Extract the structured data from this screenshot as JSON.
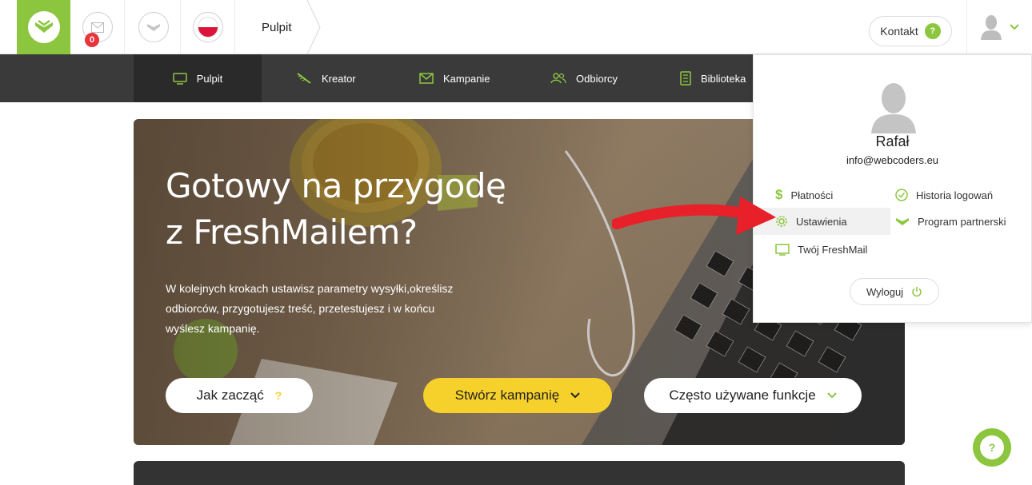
{
  "header": {
    "breadcrumb": "Pulpit",
    "messages_badge": "0",
    "contact_label": "Kontakt",
    "contact_badge": "?"
  },
  "nav": {
    "items": [
      {
        "label": "Pulpit",
        "icon": "monitor-icon"
      },
      {
        "label": "Kreator",
        "icon": "wand-icon"
      },
      {
        "label": "Kampanie",
        "icon": "envelope-icon"
      },
      {
        "label": "Odbiorcy",
        "icon": "people-icon"
      },
      {
        "label": "Biblioteka",
        "icon": "library-icon"
      }
    ]
  },
  "hero": {
    "title_line1": "Gotowy na przygodę",
    "title_line2": "z FreshMailem?",
    "description": "W kolejnych krokach ustawisz parametry wysyłki,określisz odbiorców, przygotujesz treść, przetestujesz i w końcu wyślesz kampanię.",
    "button_start": "Jak zacząć",
    "button_start_badge": "?",
    "button_create": "Stwórz kampanię",
    "button_functions": "Często używane funkcje"
  },
  "user_menu": {
    "name": "Rafał",
    "email": "info@webcoders.eu",
    "items": [
      {
        "label": "Płatności",
        "icon": "dollar-icon"
      },
      {
        "label": "Historia logowań",
        "icon": "check-circle-icon"
      },
      {
        "label": "Ustawienia",
        "icon": "gear-icon"
      },
      {
        "label": "Program partnerski",
        "icon": "leaf-icon"
      },
      {
        "label": "Twój FreshMail",
        "icon": "monitor-icon"
      }
    ],
    "logout": "Wyloguj"
  },
  "help_badge": "?",
  "colors": {
    "accent": "#8cc63f",
    "nav_bg": "#3a3a3a",
    "create_button": "#f7d12b",
    "badge_red": "#e8343a",
    "arrow_red": "#e8202a"
  }
}
